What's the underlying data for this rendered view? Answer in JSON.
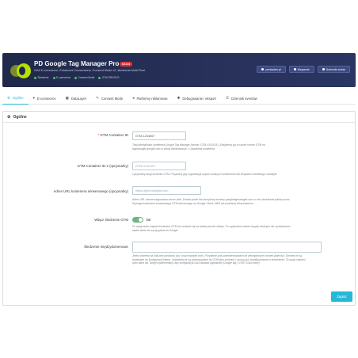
{
  "header": {
    "title": "PD Google Tag Manager Pro",
    "version": "v2.3.4",
    "subtitle": "GA4 E-commerce, Enhanced Conversions, Consent Mode v2, śledzenia Multi Pixel",
    "features": [
      "Śledzenie",
      "E-commerce",
      "Consent Mode",
      "GTM SRV/SVS"
    ],
    "buttons": [
      {
        "label": "prestadev.pl",
        "icon": "globe-icon"
      },
      {
        "label": "Wsparcie",
        "icon": "mail-icon"
      },
      {
        "label": "Dziennik zmian",
        "icon": "list-icon"
      }
    ],
    "brand_color": "#b9e000",
    "background_color": "#252f55"
  },
  "tabs": [
    {
      "label": "Ogólne",
      "icon": "gear-icon",
      "active": true
    },
    {
      "label": "E-commerce",
      "icon": "cart-icon",
      "active": false
    },
    {
      "label": "DataLayer",
      "icon": "table-icon",
      "active": false
    },
    {
      "label": "Consent Mode",
      "icon": "wrench-icon",
      "active": false
    },
    {
      "label": "Platformy reklamowe",
      "icon": "bullhorn-icon",
      "active": false
    },
    {
      "label": "Debugowanie i eksport",
      "icon": "bug-icon",
      "active": false
    },
    {
      "label": "Dziennik eventów",
      "icon": "list-icon",
      "active": false
    }
  ],
  "panel": {
    "title": "Ogólne",
    "fields": {
      "gtm_id": {
        "label": "GTM Container ID",
        "required_mark": "*",
        "value": "GTM-1234567",
        "help": "Twój identyfikator kontenera Google Tag Manager (format: GTM-XXXXXX). Znajdziesz go w swoim koncie GTM na tagmanager.google.com w sekcji Administracja > Ustawienia kontenera."
      },
      "gtm_id_2": {
        "label": "GTM Container ID 2 (opcjonalny)",
        "placeholder": "GTM-XXXXXX",
        "help": "Opcjonalny drugi kontener GTM. Przydatny gdy organizacja używa osobnych kontenerów dla zespołów marketingu i analityki."
      },
      "server_url": {
        "label": "Adres URL kontenera serwerowego (opcjonalny)",
        "placeholder": "https://gtm.example.com",
        "help": "Adres URL serwera tagowania server-side. Zostaw puste dla domyślnej domeny googletagmanager.com w celu obsłużenia plików przez. Wymaga kontenera serwerowego GTM wdrożonego na Google Cloud, AWS lub podobnej infrastrukturze."
      },
      "enable": {
        "label": "Włącz śledzenie GTM",
        "state": "Tak",
        "on": true,
        "help": "Po wyłączeniu snippet kontenera GTM nie wstawia się na każdej stronie sklepu. Po wyłączeniu żadne skrypty śledzące nie są ładowane i żadne dane nie są wysyłane do Google."
      },
      "cross_domain": {
        "label": "Śledzenie międzydomenowe",
        "value": "",
        "help": "Jedna domena na linię bez protokołu (np. shop.example.com). Przydatne przy przekierowaniach do zewnętrznych bramek płatności. Domeny te są dodawane do konfiguracji linkera. Ustawienia te są przekazywane do GTM jako zmienna i muszą być skonfigurowane w kontenerze. Ta opcja stanowi tylko dane dla Twojej implementacji, aby konfiguracja GA4 działała poprawnie (Google tag / GTM / GA4 linker)."
      }
    },
    "save_label": "Zapisz"
  }
}
